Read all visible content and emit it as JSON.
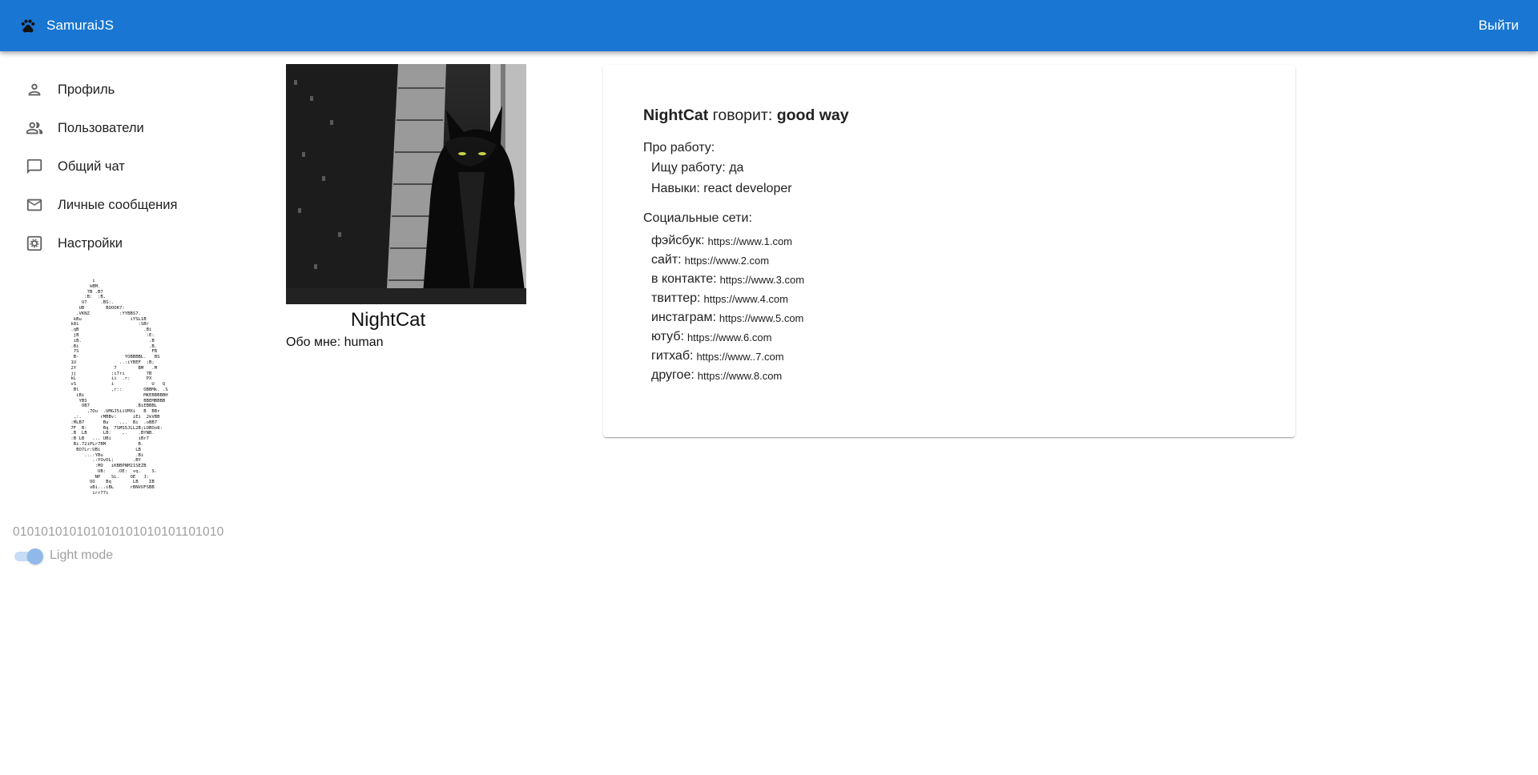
{
  "appbar": {
    "title": "SamuraiJS",
    "logout_label": "Выйти",
    "logo_icon": "paw-icon"
  },
  "sidebar": {
    "items": [
      {
        "label": "Профиль",
        "icon": "person-icon"
      },
      {
        "label": "Пользователи",
        "icon": "people-icon"
      },
      {
        "label": "Общий чат",
        "icon": "chat-bubble-icon"
      },
      {
        "label": "Личные сообщения",
        "icon": "mail-icon"
      },
      {
        "label": "Настройки",
        "icon": "settings-icon"
      }
    ],
    "binary_text": "010101010101010101010101101010",
    "theme_label": "Light mode"
  },
  "profile": {
    "name": "NightCat",
    "about": "Обо мне: human"
  },
  "info": {
    "name": "NightCat",
    "says_text": " говорит: ",
    "status": "good way",
    "job_section": "Про работу:",
    "looking_for_job": "Ищу работу: да",
    "skills": "Навыки: react developer",
    "social_section": "Социальные сети:",
    "socials": [
      {
        "label": "фэйсбук:",
        "url": "https://www.1.com"
      },
      {
        "label": "сайт:",
        "url": "https://www.2.com"
      },
      {
        "label": "в контакте:",
        "url": "https://www.3.com"
      },
      {
        "label": "твиттер:",
        "url": "https://www.4.com"
      },
      {
        "label": "инстаграм:",
        "url": "https://www.5.com"
      },
      {
        "label": "ютуб:",
        "url": "https://www.6.com"
      },
      {
        "label": "гитхаб:",
        "url": "https://www..7.com"
      },
      {
        "label": "другое:",
        "url": "https://www.8.com"
      }
    ]
  },
  "colors": {
    "appbar": "#1976d2",
    "toggle_track": "#c7dcf5",
    "toggle_thumb": "#90b9ea"
  }
}
